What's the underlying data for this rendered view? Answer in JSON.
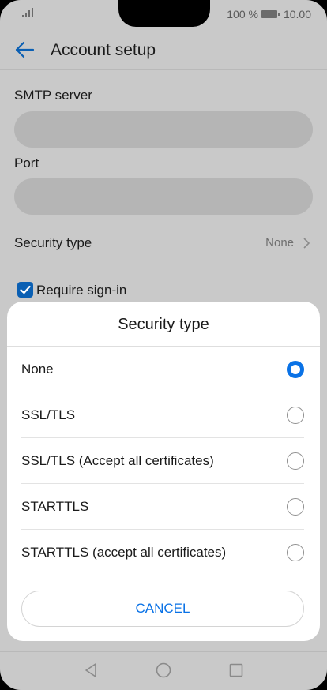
{
  "status_bar": {
    "battery_percent": "100 %",
    "time": "10.00",
    "icons": [
      "signal-icon",
      "battery-icon"
    ]
  },
  "app_bar": {
    "title": "Account setup",
    "back_icon": "arrow-left-icon"
  },
  "form": {
    "smtp_label": "SMTP server",
    "smtp_value": "",
    "port_label": "Port",
    "port_value": "",
    "security_label": "Security type",
    "security_value": "None",
    "require_signin_label": "Require sign-in",
    "require_signin_checked": true
  },
  "dialog": {
    "title": "Security type",
    "options": [
      {
        "label": "None",
        "selected": true
      },
      {
        "label": "SSL/TLS",
        "selected": false
      },
      {
        "label": "SSL/TLS (Accept all certificates)",
        "selected": false
      },
      {
        "label": "STARTTLS",
        "selected": false
      },
      {
        "label": "STARTTLS (accept all certificates)",
        "selected": false
      }
    ],
    "cancel_label": "CANCEL"
  },
  "nav_bar": {
    "icons": [
      "nav-back-icon",
      "nav-home-icon",
      "nav-recent-icon"
    ]
  },
  "colors": {
    "accent": "#0a72e6",
    "dim_background": "#c9c9c9",
    "dialog_background": "#ffffff"
  }
}
